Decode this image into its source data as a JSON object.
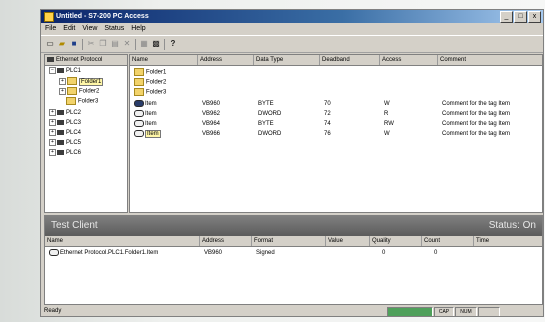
{
  "window": {
    "title": "Untitled - S7-200 PC Access",
    "minimize": "_",
    "maximize": "□",
    "close": "x"
  },
  "menu": [
    "File",
    "Edit",
    "View",
    "Status",
    "Help"
  ],
  "toolbar": {
    "icons": [
      "new-icon",
      "open-icon",
      "save-icon",
      "cut-icon",
      "copy-icon",
      "paste-icon",
      "delete-icon",
      "properties-icon",
      "monitor-icon",
      "help-icon"
    ]
  },
  "tree": {
    "root": "Ethernet Protocol",
    "plc1": "PLC1",
    "folders": [
      "Folder1",
      "Folder2",
      "Folder3"
    ],
    "plcs": [
      "PLC2",
      "PLC3",
      "PLC4",
      "PLC5",
      "PLC6"
    ]
  },
  "list": {
    "headers": [
      "Name",
      "Address",
      "Data Type",
      "Deadband",
      "Access",
      "Comment"
    ],
    "folders": [
      "Folder1",
      "Folder2",
      "Folder3"
    ],
    "items": [
      {
        "name": "Item",
        "address": "VB960",
        "type": "BYTE",
        "deadband": "70",
        "access": "W",
        "comment": "Comment for the tag Item"
      },
      {
        "name": "Item",
        "address": "VB962",
        "type": "DWORD",
        "deadband": "72",
        "access": "R",
        "comment": "Comment for the tag Item"
      },
      {
        "name": "Item",
        "address": "VB964",
        "type": "BYTE",
        "deadband": "74",
        "access": "RW",
        "comment": "Comment for the tag Item"
      },
      {
        "name": "Item",
        "address": "VB966",
        "type": "DWORD",
        "deadband": "76",
        "access": "W",
        "comment": "Comment for the tag Item"
      }
    ]
  },
  "test_client": {
    "title": "Test Client",
    "status": "Status: On",
    "headers": [
      "Name",
      "Address",
      "Format",
      "Value",
      "Quality",
      "Count",
      "Time"
    ],
    "rows": [
      {
        "name": "Ethernet Protocol.PLC1.Folder1.Item",
        "address": "VB960",
        "format": "Signed",
        "value": "",
        "quality": "0",
        "count": "0",
        "time": ""
      }
    ]
  },
  "status": {
    "ready": "Ready",
    "cap": "CAP",
    "num": "NUM"
  },
  "colors": {
    "titlebar": "#0a246a",
    "selection": "#fff7a8",
    "folder": "#f2d36b",
    "chrome": "#d4d0c8"
  }
}
